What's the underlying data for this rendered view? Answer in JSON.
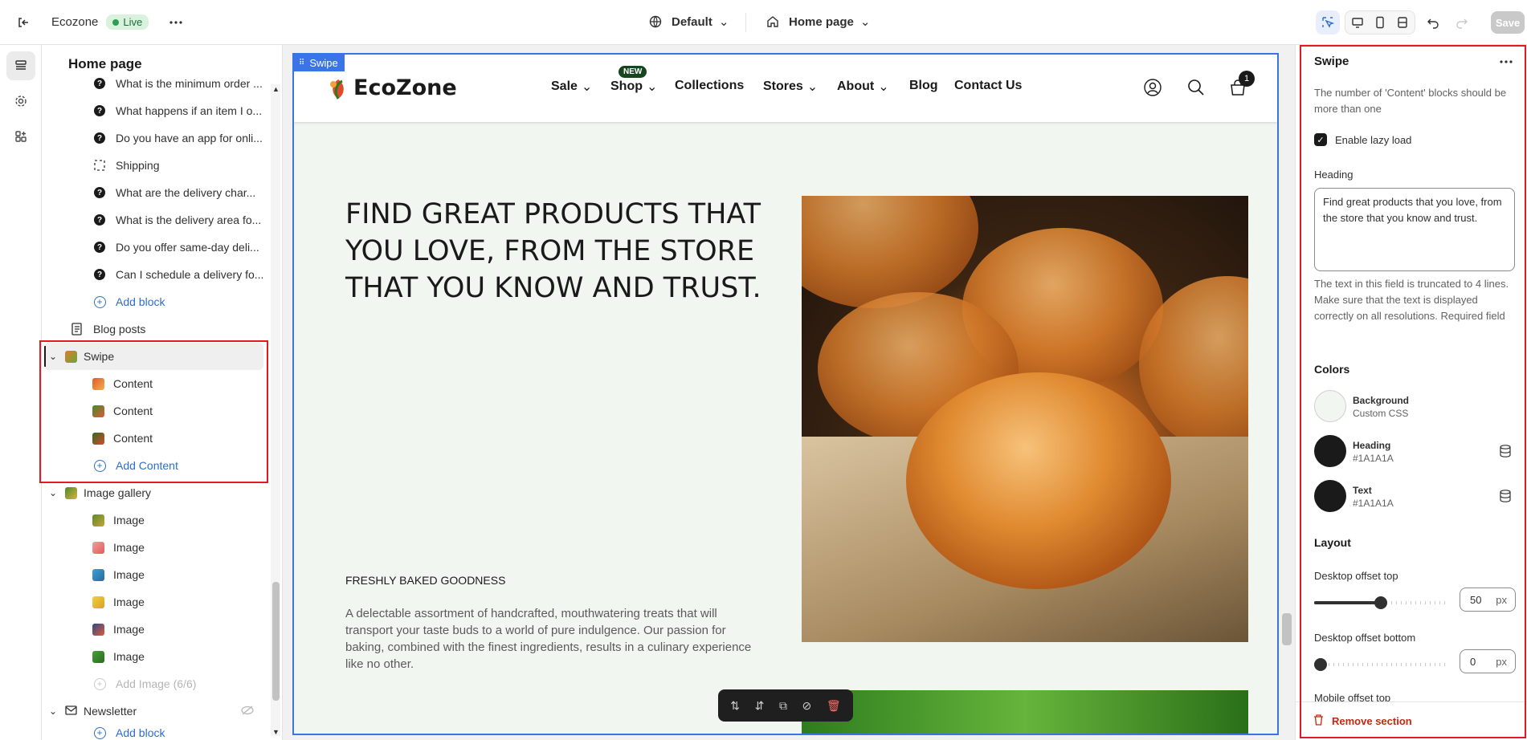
{
  "topbar": {
    "store_name": "Ecozone",
    "status": "Live",
    "theme": "Default",
    "page": "Home page",
    "save_label": "Save"
  },
  "left_panel": {
    "title": "Home page",
    "faq_items": [
      "What is the minimum order ...",
      "What happens if an item I o...",
      "Do you have an app for onli...",
      "Shipping",
      "What are the delivery char...",
      "What is the delivery area fo...",
      "Do you offer same-day deli...",
      "Can I schedule a delivery fo..."
    ],
    "add_block": "Add block",
    "blog_posts": "Blog posts",
    "swipe": {
      "label": "Swipe",
      "contents": [
        "Content",
        "Content",
        "Content"
      ],
      "add_content": "Add Content"
    },
    "image_gallery": {
      "label": "Image gallery",
      "images": [
        "Image",
        "Image",
        "Image",
        "Image",
        "Image",
        "Image"
      ],
      "add_image": "Add Image (6/6)"
    },
    "newsletter": "Newsletter",
    "add_block_2": "Add block"
  },
  "preview": {
    "section_tag": "Swipe",
    "logo_text": "EcoZone",
    "nav": [
      "Sale",
      "Shop",
      "Collections",
      "Stores",
      "About",
      "Blog",
      "Contact Us"
    ],
    "new_badge": "NEW",
    "cart_count": "1",
    "heading": "FIND GREAT PRODUCTS THAT YOU LOVE, FROM THE STORE THAT YOU KNOW AND TRUST.",
    "subheading": "FRESHLY BAKED GOODNESS",
    "text": "A delectable assortment of handcrafted, mouthwatering treats that will transport your taste buds to a world of pure indulgence. Our passion for baking, combined with the finest ingredients, results in a culinary experience like no other."
  },
  "settings": {
    "title": "Swipe",
    "notice": "The number of 'Content' blocks should be more than one",
    "lazy_load_label": "Enable lazy load",
    "lazy_load_checked": true,
    "heading_label": "Heading",
    "heading_value": "Find great products that you love, from the store that you know and trust.",
    "heading_help": "The text in this field is truncated to 4 lines. Make sure that the text is displayed correctly on all resolutions. Required field",
    "colors_title": "Colors",
    "colors": [
      {
        "name": "Background",
        "value": "Custom CSS",
        "hex": "#F1F6F1"
      },
      {
        "name": "Heading",
        "value": "#1A1A1A",
        "hex": "#1A1A1A"
      },
      {
        "name": "Text",
        "value": "#1A1A1A",
        "hex": "#1A1A1A"
      }
    ],
    "layout_title": "Layout",
    "desktop_offset_top_label": "Desktop offset top",
    "desktop_offset_top": "50",
    "desktop_offset_bottom_label": "Desktop offset bottom",
    "desktop_offset_bottom": "0",
    "unit": "px",
    "mobile_offset_top_label": "Mobile offset top",
    "remove_section": "Remove section"
  }
}
